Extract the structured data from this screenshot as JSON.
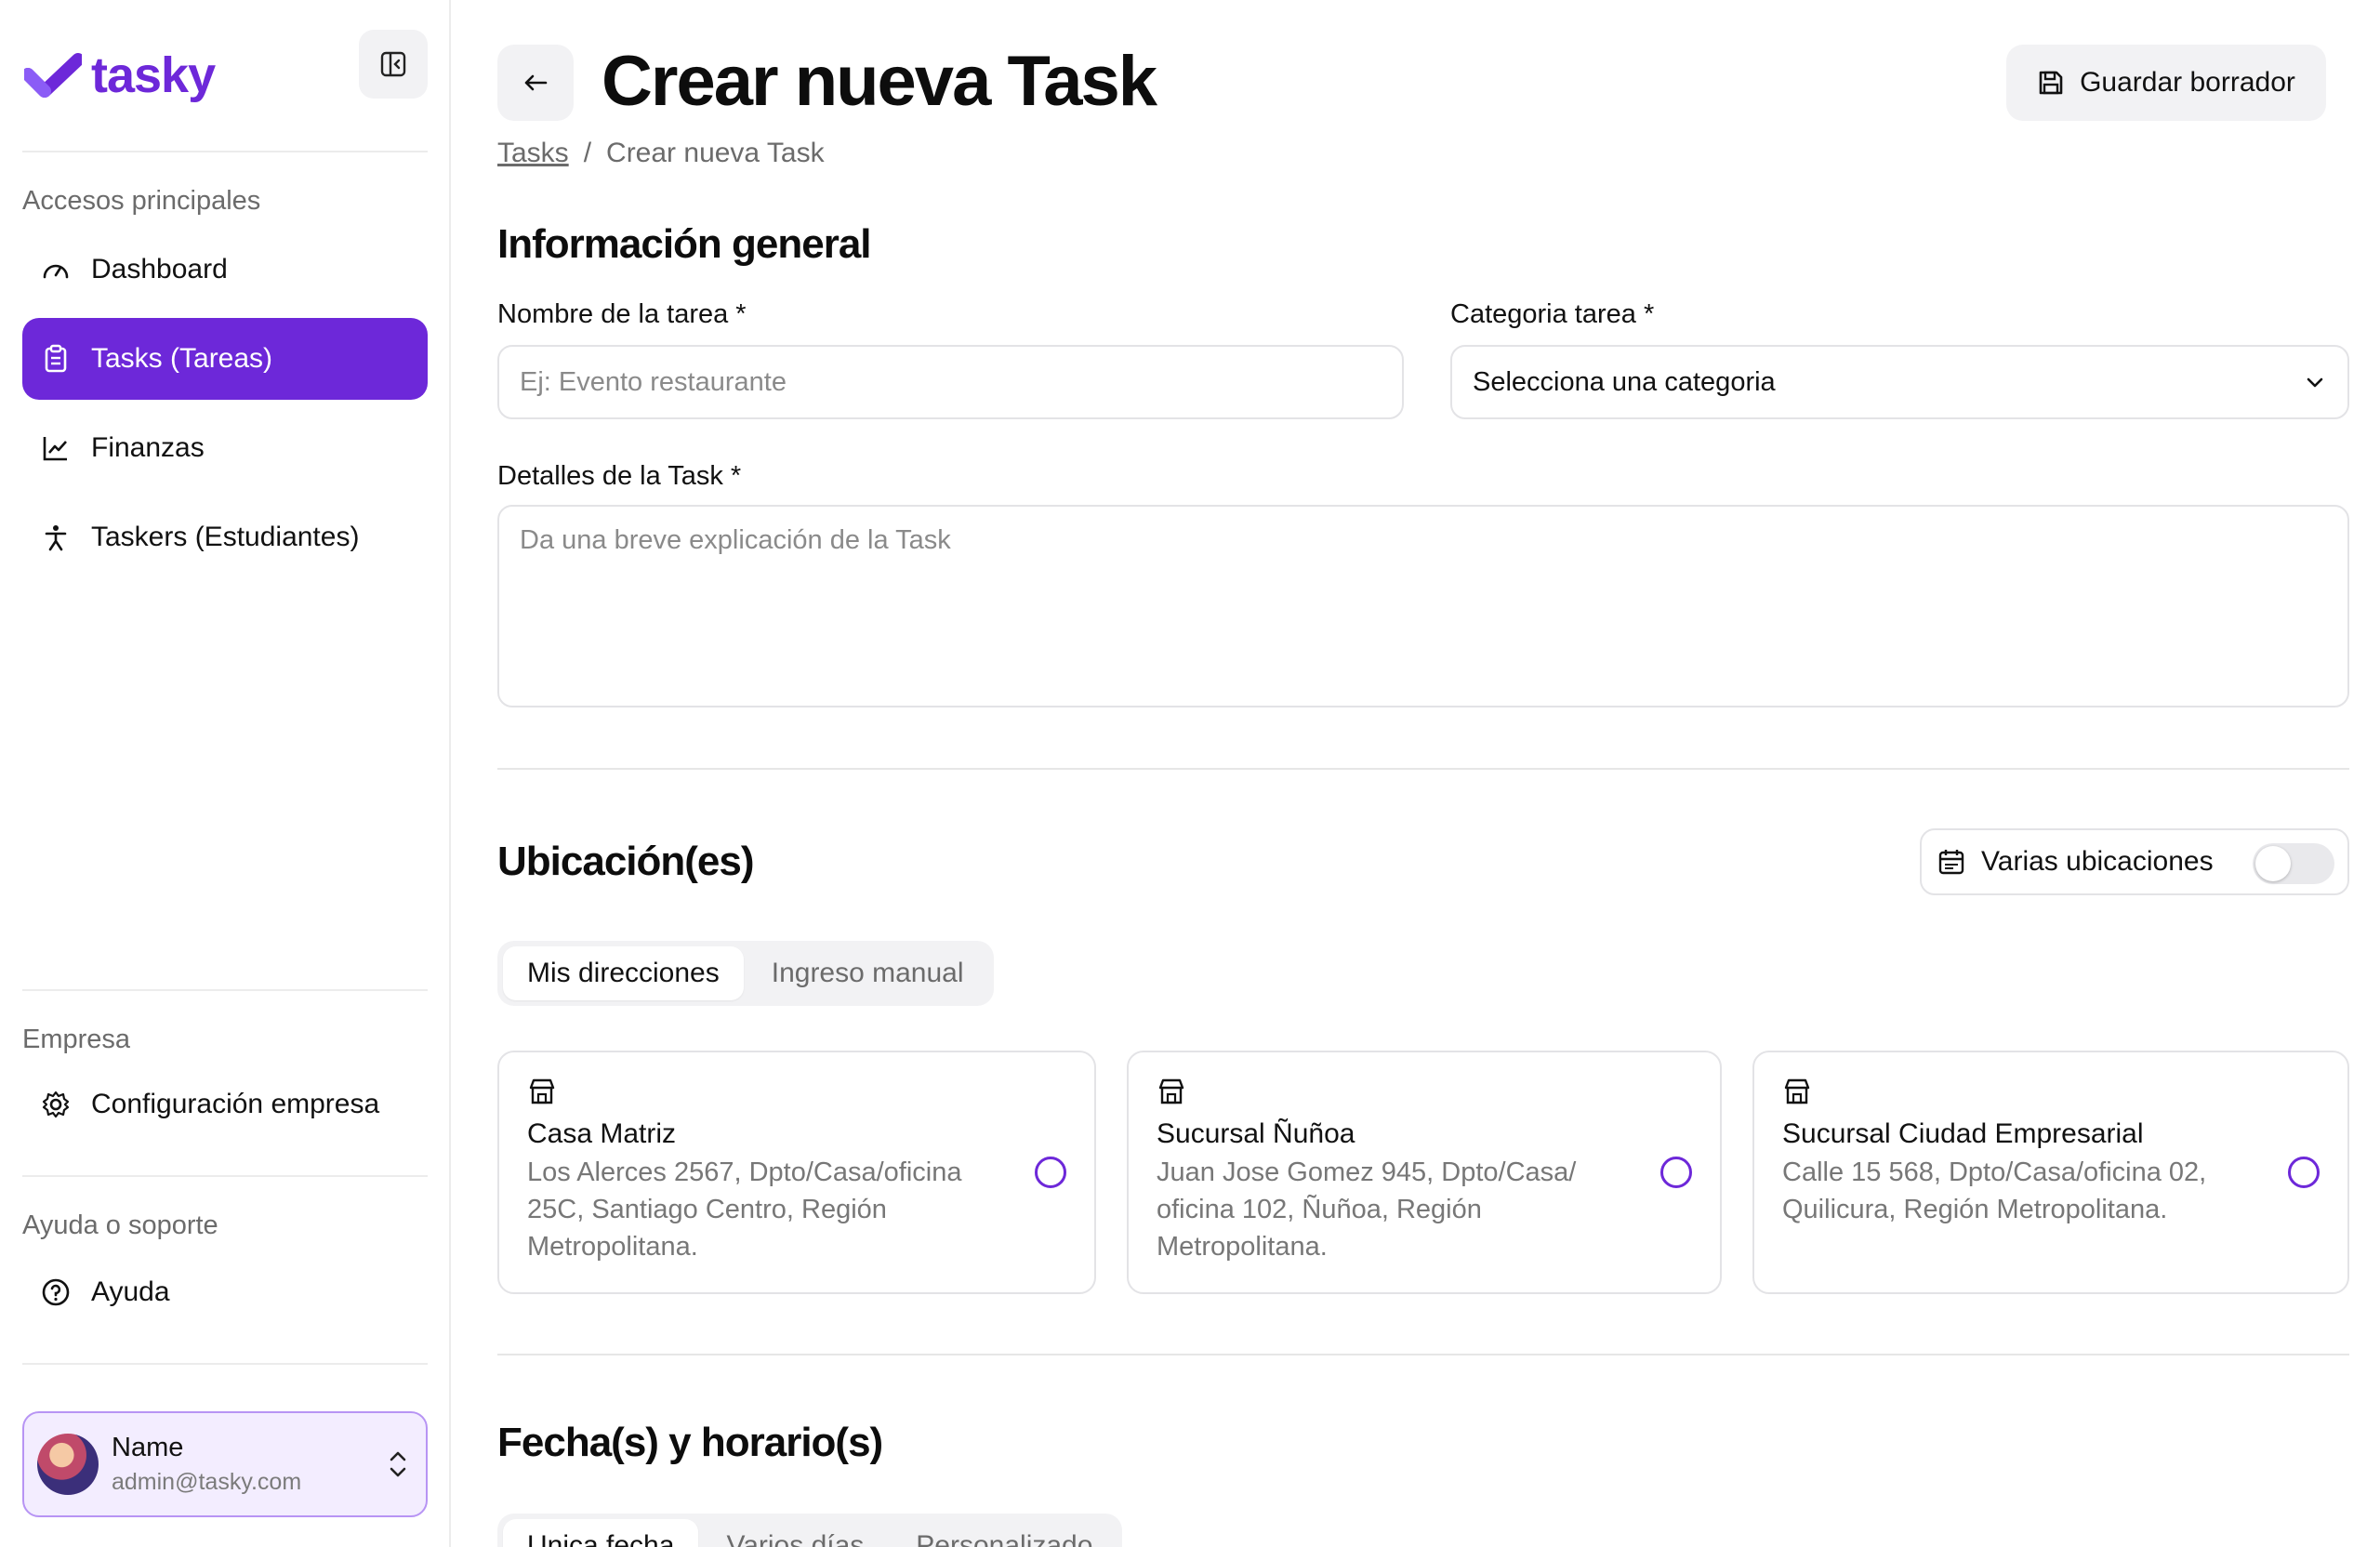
{
  "app": {
    "logo_text": "tasky",
    "brand_color": "#6d28d9"
  },
  "sidebar": {
    "sections": {
      "main_label": "Accesos principales",
      "company_label": "Empresa",
      "help_label": "Ayuda o soporte"
    },
    "items": [
      {
        "label": "Dashboard",
        "icon": "gauge-icon",
        "active": false
      },
      {
        "label": "Tasks (Tareas)",
        "icon": "clipboard-icon",
        "active": true
      },
      {
        "label": "Finanzas",
        "icon": "chart-line-icon",
        "active": false
      },
      {
        "label": "Taskers (Estudiantes)",
        "icon": "person-icon",
        "active": false
      }
    ],
    "company_items": [
      {
        "label": "Configuración empresa",
        "icon": "gear-icon"
      }
    ],
    "help_items": [
      {
        "label": "Ayuda",
        "icon": "help-circle-icon"
      }
    ],
    "user": {
      "name": "Name",
      "email": "admin@tasky.com"
    }
  },
  "header": {
    "title": "Crear nueva Task",
    "draft_button": "Guardar borrador",
    "breadcrumb": {
      "link": "Tasks",
      "separator": "/",
      "current": "Crear nueva Task"
    }
  },
  "general": {
    "title": "Información general",
    "name_label": "Nombre de la tarea *",
    "name_placeholder": "Ej: Evento restaurante",
    "category_label": "Categoria tarea *",
    "category_value": "Selecciona una categoria",
    "details_label": "Detalles de la Task *",
    "details_placeholder": "Da una breve explicación de la Task"
  },
  "locations": {
    "title": "Ubicación(es)",
    "multi_toggle_label": "Varias ubicaciones",
    "multi_toggle_on": false,
    "tabs": [
      {
        "label": "Mis direcciones",
        "active": true
      },
      {
        "label": "Ingreso manual",
        "active": false
      }
    ],
    "addresses": [
      {
        "name": "Casa Matriz",
        "address": "Los Alerces 2567, Dpto/Casa/oficina 25C, Santiago Centro, Región Metropolitana."
      },
      {
        "name": "Sucursal Ñuñoa",
        "address": "Juan Jose Gomez 945, Dpto/Casa/ oficina 102, Ñuñoa, Región Metropolitana."
      },
      {
        "name": "Sucursal Ciudad Empresarial",
        "address": "Calle 15 568, Dpto/Casa/oficina 02, Quilicura, Región Metropolitana."
      }
    ]
  },
  "schedule": {
    "title": "Fecha(s) y horario(s)",
    "tabs": [
      {
        "label": "Unica fecha",
        "active": true
      },
      {
        "label": "Varios días",
        "active": false
      },
      {
        "label": "Personalizado",
        "active": false
      }
    ]
  }
}
